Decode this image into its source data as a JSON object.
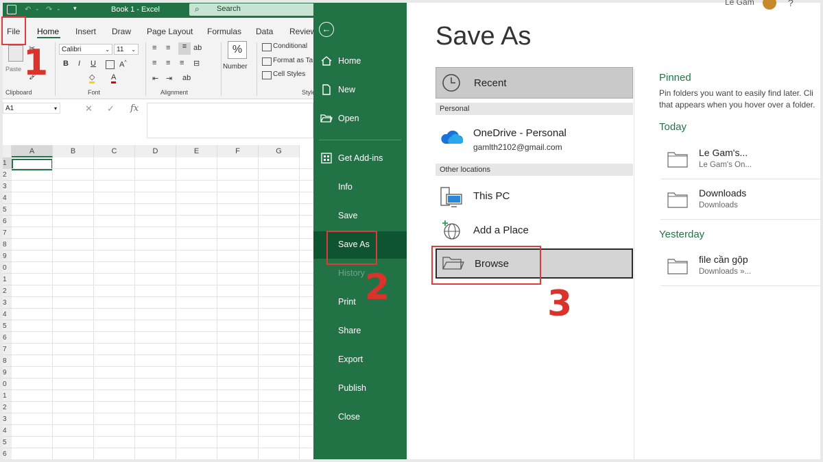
{
  "excel": {
    "qat": {
      "doc_title": "Book 1  -  Excel",
      "search_placeholder": "Search",
      "user": "Le Gam"
    },
    "tabs": [
      "File",
      "Home",
      "Insert",
      "Draw",
      "Page Layout",
      "Formulas",
      "Data",
      "Review"
    ],
    "ribbon": {
      "paste_label": "Paste",
      "font_name": "Calibri",
      "font_size": "11",
      "bold": "B",
      "italic": "I",
      "underline": "U",
      "number_label": "Number",
      "percent": "%",
      "conditional": "Conditional",
      "format_as_table": "Format as Ta",
      "cell_styles": "Cell Styles",
      "groups": {
        "clipboard": "Clipboard",
        "font": "Font",
        "alignment": "Alignment",
        "styles": "Style"
      }
    },
    "name_box": "A1",
    "fx": "fx",
    "columns": [
      "A",
      "B",
      "C",
      "D",
      "E",
      "F",
      "G"
    ],
    "rows": [
      "1",
      "2",
      "3",
      "4",
      "5",
      "6",
      "7",
      "8",
      "9",
      "0",
      "1",
      "2",
      "3",
      "4",
      "5",
      "6",
      "7",
      "8",
      "9",
      "0",
      "1",
      "2",
      "3",
      "4",
      "5",
      "6"
    ]
  },
  "backstage": {
    "menu": [
      {
        "label": "Home",
        "icon": "home-icon"
      },
      {
        "label": "New",
        "icon": "new-doc-icon"
      },
      {
        "label": "Open",
        "icon": "folder-open-icon"
      },
      {
        "label": "Get Add-ins",
        "icon": "grid-icon"
      },
      {
        "label": "Info"
      },
      {
        "label": "Save"
      },
      {
        "label": "Save As",
        "active": true
      },
      {
        "label": "History",
        "disabled": true
      },
      {
        "label": "Print"
      },
      {
        "label": "Share"
      },
      {
        "label": "Export"
      },
      {
        "label": "Publish"
      },
      {
        "label": "Close"
      }
    ]
  },
  "save_as": {
    "title": "Save As",
    "recent": "Recent",
    "personal_section": "Personal",
    "onedrive_name": "OneDrive - Personal",
    "onedrive_email": "gamlth2102@gmail.com",
    "other_section": "Other locations",
    "this_pc": "This PC",
    "add_place": "Add a Place",
    "browse": "Browse",
    "pinned_head": "Pinned",
    "pinned_text_1": "Pin folders you want to easily find later. Cli",
    "pinned_text_2": "that appears when you hover over a folder.",
    "today_head": "Today",
    "yesterday_head": "Yesterday",
    "folders": [
      {
        "name": "Le Gam's...",
        "path": "Le Gam's On..."
      },
      {
        "name": "Downloads",
        "path": "Downloads"
      },
      {
        "name": "file cần gộp",
        "path": "Downloads »..."
      }
    ]
  },
  "annotations": {
    "step1": "1",
    "step2": "2",
    "step3": "3"
  },
  "colors": {
    "excel_green": "#217346",
    "active_menu": "#0f5430",
    "annotation_red": "#d9332b"
  }
}
